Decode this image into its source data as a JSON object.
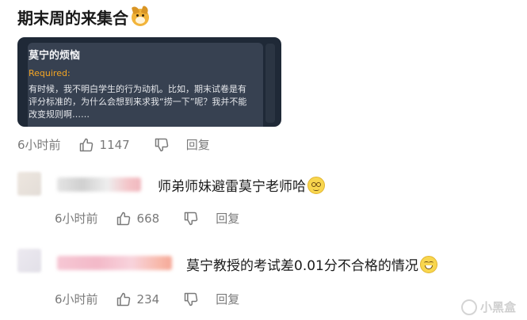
{
  "post": {
    "title": "期末周的来集合",
    "card": {
      "title": "莫宁的烦恼",
      "required_label": "Required:",
      "body": "有时候，我不明白学生的行为动机。比如，期末试卷是有评分标准的，为什么会想到来求我“捞一下”呢？我并不能改变规则啊……"
    },
    "time": "6小时前",
    "likes": "1147",
    "reply_label": "回复"
  },
  "comments": [
    {
      "text": "师弟师妹避雷莫宁老师哈",
      "emoji": "cool-face-icon",
      "time": "6小时前",
      "likes": "668",
      "reply_label": "回复"
    },
    {
      "text": "莫宁教授的考试差0.01分不合格的情况",
      "emoji": "happy-face-icon",
      "time": "6小时前",
      "likes": "234",
      "reply_label": "回复"
    }
  ],
  "watermark": "小黑盒",
  "colors": {
    "card_bg": "#1f2937",
    "required": "#f5a623",
    "meta_text": "#7a7a7a"
  }
}
